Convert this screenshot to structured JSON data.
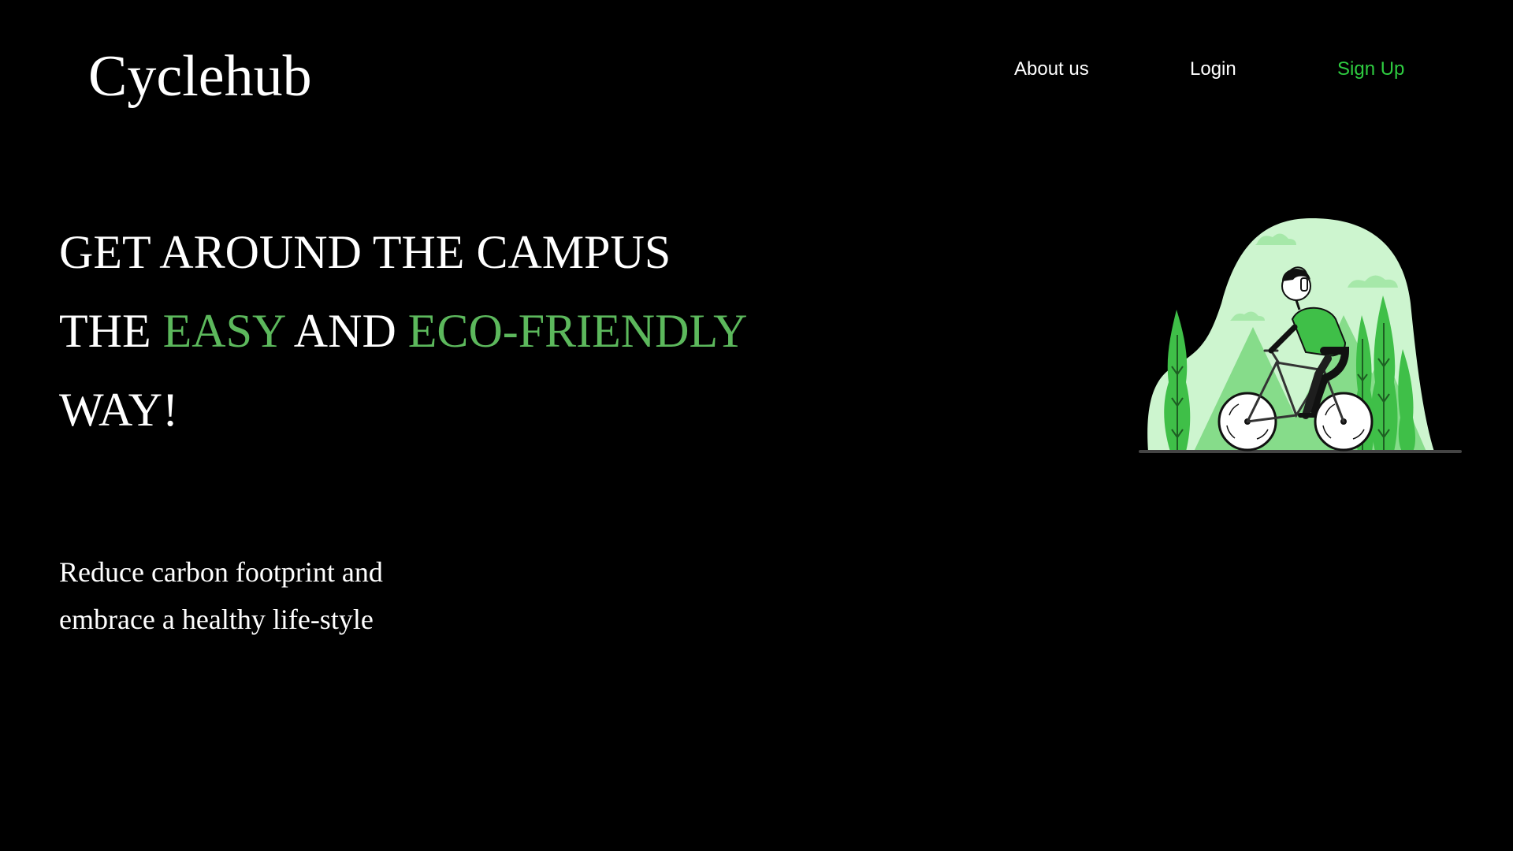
{
  "brand": {
    "name": "Cyclehub"
  },
  "nav": {
    "about_label": "About us",
    "login_label": "Login",
    "signup_label": "Sign Up"
  },
  "hero": {
    "headline": {
      "line1": "GET AROUND THE CAMPUS",
      "line2_part1": "THE ",
      "line2_accent1": "EASY",
      "line2_part2": " AND ",
      "line2_accent2": "ECO-FRIENDLY",
      "line3": "WAY!"
    },
    "subtext": {
      "line1": "Reduce carbon footprint and",
      "line2": "embrace a healthy life-style"
    },
    "illustration_icon": "cyclist-in-forest-illustration"
  },
  "colors": {
    "background": "#000000",
    "text": "#ffffff",
    "accent_green": "#5cb85c",
    "signup_green": "#2ecc40",
    "illustration_light": "#cdf5cf",
    "illustration_mid": "#86dc8a",
    "illustration_dark": "#3fbf48"
  }
}
